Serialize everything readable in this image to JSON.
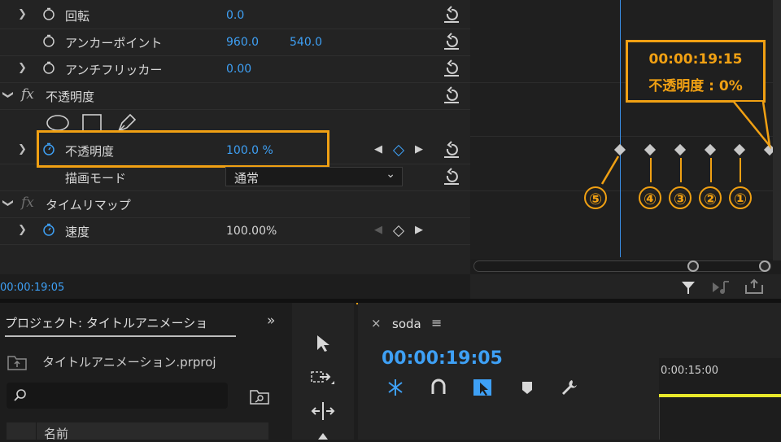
{
  "effect_controls": {
    "rows": [
      {
        "label": "回転",
        "value1": "0.0"
      },
      {
        "label": "アンカーポイント",
        "value1": "960.0",
        "value2": "540.0"
      },
      {
        "label": "アンチフリッカー",
        "value1": "0.00"
      },
      {
        "label": "不透明度"
      },
      {
        "label": "不透明度",
        "value1": "100.0 %"
      },
      {
        "label": "描画モード",
        "value1": "通常"
      },
      {
        "label": "タイムリマップ"
      },
      {
        "label": "速度",
        "value1": "100.00%"
      }
    ],
    "fx_label": "fx",
    "current_time": "00:00:19:05"
  },
  "annotation": {
    "time": "00:00:19:15",
    "text": "不透明度 : 0%",
    "markers": [
      "⑤",
      "④",
      "③",
      "②",
      "①"
    ],
    "color": "#f0a013"
  },
  "project": {
    "title": "プロジェクト: タイトルアニメーショ",
    "file": "タイトルアニメーション.prproj",
    "search_placeholder": "",
    "column_name": "名前",
    "expand_icon": "double-chevron-icon"
  },
  "sequence": {
    "name": "soda",
    "timecode": "00:00:19:05",
    "ruler_label": "0:00:15:00"
  },
  "colors": {
    "accent_blue": "#3ea0f5",
    "playhead": "#3a8ee6",
    "highlight": "#f0a013",
    "work_area": "#e8e82a"
  }
}
